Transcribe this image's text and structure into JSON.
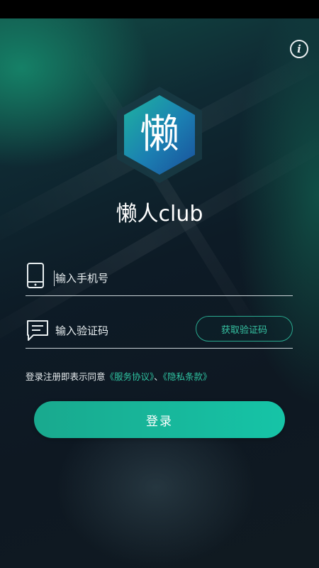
{
  "app": {
    "brand_name": "懒人club",
    "logo_char": "懒"
  },
  "header": {
    "info_icon": "i"
  },
  "phone": {
    "icon": "phone-icon",
    "placeholder": "输入手机号"
  },
  "code": {
    "icon": "message-icon",
    "placeholder": "输入验证码",
    "get_code_label": "获取验证码"
  },
  "agreement": {
    "prefix": "登录注册即表示同意",
    "service_link": "《服务协议》",
    "separator": "、",
    "privacy_link": "《隐私条款》"
  },
  "login": {
    "label": "登录"
  },
  "colors": {
    "accent": "#16c4a7",
    "link": "#2fc4a2",
    "background": "#0e1a24"
  }
}
